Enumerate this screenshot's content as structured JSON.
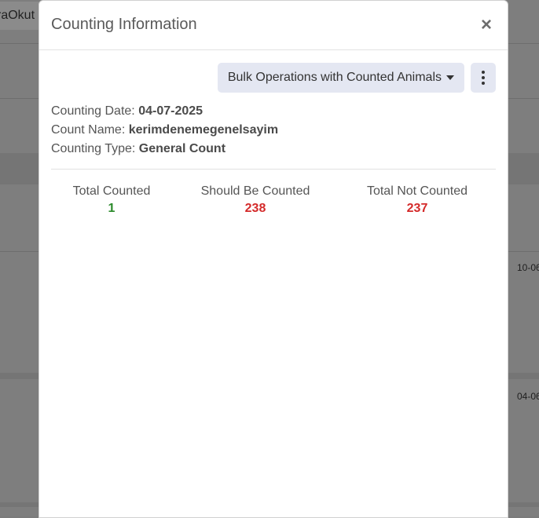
{
  "background": {
    "top_button_label": "raOkut",
    "dates": [
      "10-06",
      "04-06"
    ]
  },
  "modal": {
    "title": "Counting Information",
    "close_glyph": "×",
    "bulk_button_label": "Bulk Operations with Counted Animals",
    "counting_date_label": "Counting Date:",
    "counting_date_value": "04-07-2025",
    "count_name_label": "Count Name:",
    "count_name_value": "kerimdenemegenelsayim",
    "counting_type_label": "Counting Type:",
    "counting_type_value": "General Count",
    "stats": [
      {
        "label": "Total Counted",
        "value": "1",
        "color": "#2b8a2b"
      },
      {
        "label": "Should Be Counted",
        "value": "238",
        "color": "#d42a2a"
      },
      {
        "label": "Total Not Counted",
        "value": "237",
        "color": "#d42a2a"
      }
    ]
  },
  "icons": {
    "close": "close-icon",
    "caret": "caret-down-icon",
    "more": "more-vertical-icon"
  }
}
